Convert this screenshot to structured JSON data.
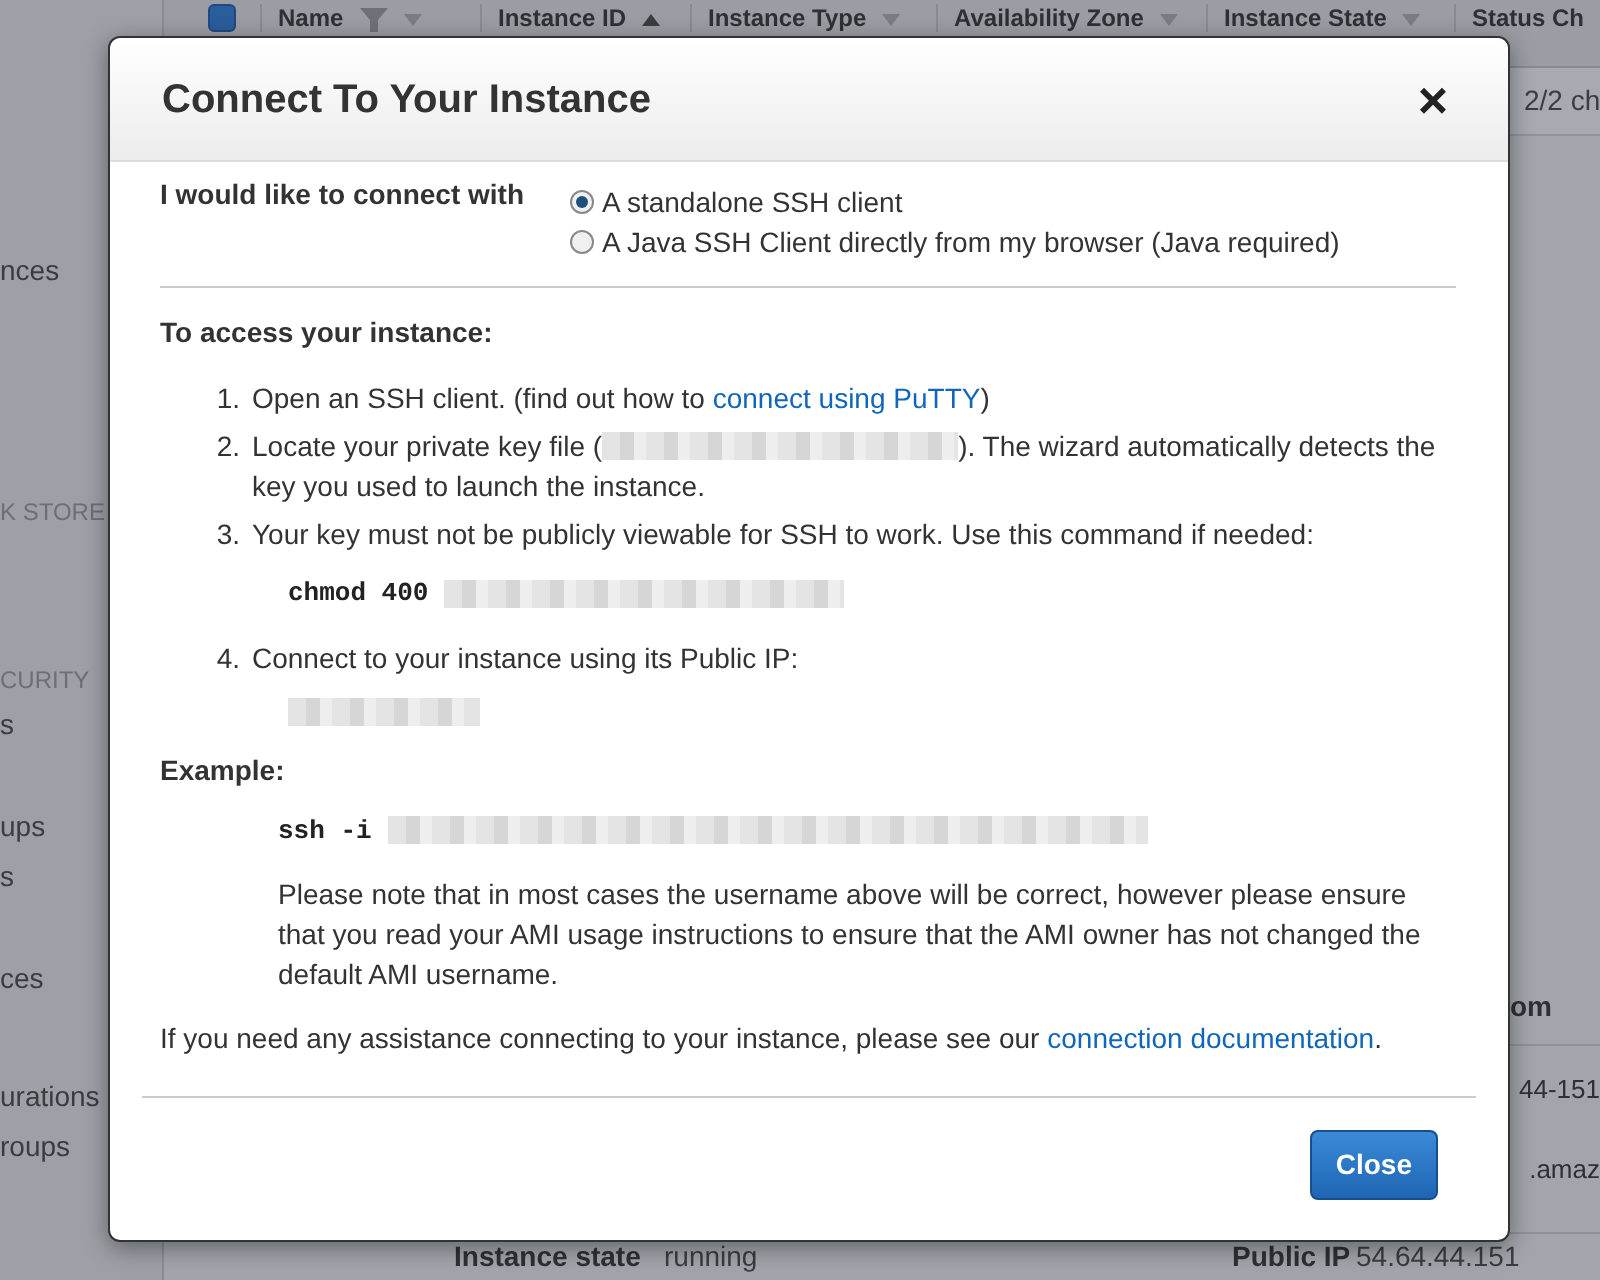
{
  "background": {
    "sidebar": [
      {
        "text": "nces",
        "kind": "link"
      },
      {
        "text": "K STORE",
        "kind": "heading"
      },
      {
        "text": "CURITY",
        "kind": "heading"
      },
      {
        "text": "s",
        "kind": "link"
      },
      {
        "text": "ups",
        "kind": "link"
      },
      {
        "text": "s",
        "kind": "link"
      },
      {
        "text": "ces",
        "kind": "link"
      },
      {
        "text": "urations",
        "kind": "link"
      },
      {
        "text": "roups",
        "kind": "link"
      }
    ],
    "table": {
      "select_all": {
        "checked": true
      },
      "columns": [
        {
          "label": "Name",
          "sorted": false,
          "filter": true
        },
        {
          "label": "Instance ID",
          "sorted": true,
          "filter": false
        },
        {
          "label": "Instance Type",
          "sorted": false,
          "filter": false
        },
        {
          "label": "Availability Zone",
          "sorted": false,
          "filter": false
        },
        {
          "label": "Instance State",
          "sorted": false,
          "filter": false
        },
        {
          "label": "Status Ch",
          "filter": false
        }
      ],
      "rows": [
        {
          "status_checks": "2/2 ch"
        }
      ]
    },
    "details": {
      "heading": "om",
      "lines": [
        "44-151",
        ".amaz"
      ],
      "fields": [
        {
          "label": "Instance state",
          "value": "running"
        },
        {
          "label": "Public IP",
          "value": "54.64.44.151"
        }
      ]
    }
  },
  "dialog": {
    "title": "Connect To Your Instance",
    "close": "×",
    "connect_label": "I would like to connect with",
    "options": [
      {
        "label": "A standalone SSH client",
        "selected": true
      },
      {
        "label": "A Java SSH Client directly from my browser (Java required)",
        "selected": false
      }
    ],
    "access_heading": "To access your instance:",
    "steps": [
      {
        "number": "1.",
        "parts": [
          {
            "kind": "text",
            "text": "Open an SSH client. (find out how to "
          },
          {
            "kind": "link",
            "text": "connect using PuTTY"
          },
          {
            "kind": "text",
            "text": ")"
          }
        ]
      },
      {
        "number": "2.",
        "parts": [
          {
            "kind": "text",
            "text": "Locate your private key file ("
          },
          {
            "kind": "redacted-file"
          },
          {
            "kind": "text",
            "text": "). The wizard automatically detects the key you used to launch the instance."
          }
        ]
      },
      {
        "number": "3.",
        "parts": [
          {
            "kind": "text",
            "text": "Your key must not be publicly viewable for SSH to work. Use this command if needed:"
          }
        ],
        "command_parts": [
          {
            "kind": "command",
            "text": "chmod 400"
          },
          {
            "kind": "redacted-path"
          }
        ]
      },
      {
        "number": "4.",
        "parts": [
          {
            "kind": "text",
            "text": "Connect to your instance using its Public IP:"
          }
        ],
        "command_parts": [
          {
            "kind": "redacted-ip"
          }
        ]
      }
    ],
    "example_heading": "Example:",
    "example_command_parts": [
      {
        "kind": "command",
        "text": "ssh -i"
      },
      {
        "kind": "redacted-long"
      }
    ],
    "example_note": "Please note that in most cases the username above will be correct, however please ensure that you read your AMI usage instructions to ensure that the AMI owner has not changed the default AMI username.",
    "help": {
      "text": "If you need any assistance connecting to your instance, please see our ",
      "link": "connection documentation",
      "after": "."
    },
    "buttons": [
      {
        "label": "Close",
        "kind": "primary"
      }
    ]
  }
}
